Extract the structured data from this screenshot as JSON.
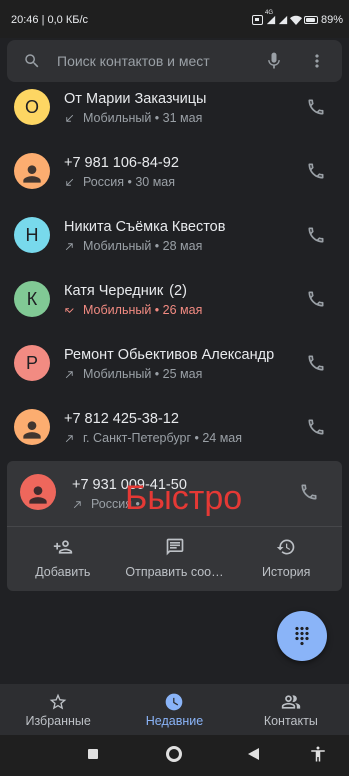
{
  "status_bar": {
    "time_and_speed": "20:46 | 0,0 КБ/с",
    "network_type": "4G",
    "battery_percent": "89%",
    "battery_level": 0.89,
    "icons": [
      "status-box-icon",
      "signal-icon",
      "signal-icon",
      "wifi-icon",
      "battery-icon"
    ]
  },
  "search": {
    "placeholder": "Поиск контактов и мест",
    "value": "",
    "icons": [
      "search-icon",
      "mic-icon",
      "more-vert-icon"
    ]
  },
  "calls": [
    {
      "name": "От Марии Заказчицы",
      "call_type": "incoming",
      "icon": "incoming-call-icon",
      "detail": "Мобильный • 31 мая",
      "avatar_letter": "О",
      "avatar_color": "#fdd663"
    },
    {
      "name": "+7 981 106-84-92",
      "call_type": "incoming",
      "icon": "incoming-call-icon",
      "detail": "Россия • 30 мая",
      "avatar_icon": "person-icon",
      "avatar_color": "#fcad70"
    },
    {
      "name": "Никита Съёмка Квестов",
      "call_type": "outgoing",
      "icon": "outgoing-call-icon",
      "detail": "Мобильный • 28 мая",
      "avatar_letter": "Н",
      "avatar_color": "#78d9ec"
    },
    {
      "name": "Катя Чередник",
      "count": "(2)",
      "call_type": "missed",
      "icon": "missed-call-icon",
      "detail": "Мобильный • 26 мая",
      "avatar_letter": "К",
      "avatar_color": "#81c995"
    },
    {
      "name": "Ремонт Обьективов Александр",
      "call_type": "outgoing",
      "icon": "outgoing-call-icon",
      "detail": "Мобильный • 25 мая",
      "avatar_letter": "Р",
      "avatar_color": "#f28b82"
    },
    {
      "name": "+7 812 425-38-12",
      "call_type": "outgoing",
      "icon": "outgoing-call-icon",
      "detail": "г. Санкт-Петербург • 24 мая",
      "avatar_icon": "person-icon",
      "avatar_color": "#fcad70"
    }
  ],
  "expanded_call": {
    "name": "+7 931 009-41-50",
    "call_type": "outgoing",
    "icon": "outgoing-call-icon",
    "detail": "Россия •",
    "avatar_icon": "person-icon",
    "avatar_color": "#ee675c",
    "actions": [
      {
        "label": "Добавить",
        "icon": "add-person-icon"
      },
      {
        "label": "Отправить соо…",
        "icon": "message-icon"
      },
      {
        "label": "История",
        "icon": "history-icon"
      }
    ]
  },
  "overlay": {
    "text": "Быстро",
    "color": "#e53935"
  },
  "fab": {
    "icon": "dialpad-icon",
    "color": "#8ab4f8"
  },
  "tabs": [
    {
      "label": "Избранные",
      "icon": "star-icon",
      "active": false
    },
    {
      "label": "Недавние",
      "icon": "clock-icon",
      "active": true
    },
    {
      "label": "Контакты",
      "icon": "people-icon",
      "active": false
    }
  ],
  "system_nav": {
    "buttons": [
      "overview-square-icon",
      "home-circle-icon",
      "back-triangle-icon",
      "accessibility-icon"
    ]
  },
  "colors": {
    "background": "#202124",
    "surface": "#303134",
    "text_primary": "#e8eaed",
    "text_secondary": "#9aa0a6",
    "missed_call": "#f28b82",
    "accent": "#8ab4f8"
  }
}
